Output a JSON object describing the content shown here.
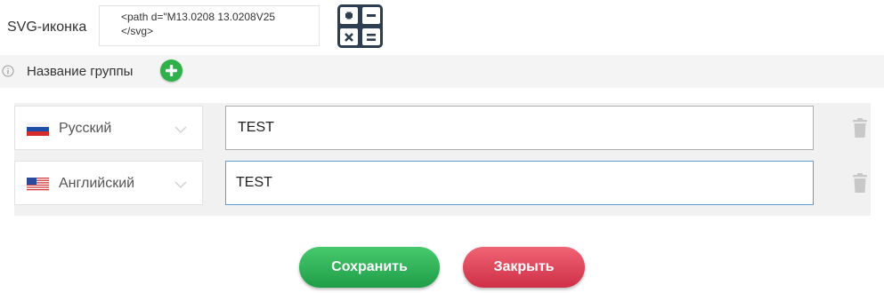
{
  "svg_field": {
    "label": "SVG-иконка",
    "value": "<path d=\"M13.0208 13.0208V25\n</svg>"
  },
  "icons": {
    "calculator": "calculator-icon",
    "info": "info-icon",
    "add": "plus-icon",
    "trash": "trash-icon",
    "chevron": "chevron-down-icon"
  },
  "group": {
    "label": "Название группы"
  },
  "translations": [
    {
      "language": "Русский",
      "flag": "flag-ru-icon",
      "value": "TEST"
    },
    {
      "language": "Английский",
      "flag": "flag-us-icon",
      "value": "TEST"
    }
  ],
  "actions": {
    "save_label": "Сохранить",
    "close_label": "Закрыть"
  },
  "colors": {
    "calc_bg": "#2d3e50",
    "add_green": "#2fb04a",
    "save_green": "#2fb654",
    "close_red": "#e0455c",
    "focus_border": "#5b9ed6"
  }
}
